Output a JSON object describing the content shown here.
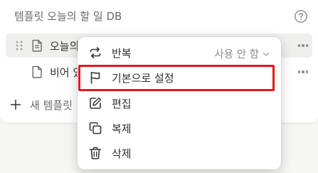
{
  "panel": {
    "title": "템플릿 오늘의 할 일 DB",
    "templates": [
      {
        "label": "오늘의 할 일"
      },
      {
        "label": "비어 있음"
      }
    ],
    "new_template_label": "새 템플릿"
  },
  "menu": {
    "items": [
      {
        "label": "반복",
        "value": "사용 안 함",
        "icon": "repeat-icon"
      },
      {
        "label": "기본으로 설정",
        "icon": "flag-icon"
      },
      {
        "label": "편집",
        "icon": "edit-icon"
      },
      {
        "label": "복제",
        "icon": "duplicate-icon"
      },
      {
        "label": "삭제",
        "icon": "trash-icon"
      }
    ]
  },
  "colors": {
    "highlight_box": "#e8151c",
    "row_hover": "#efefed",
    "text": "#37352f",
    "muted": "#8c8b88"
  }
}
